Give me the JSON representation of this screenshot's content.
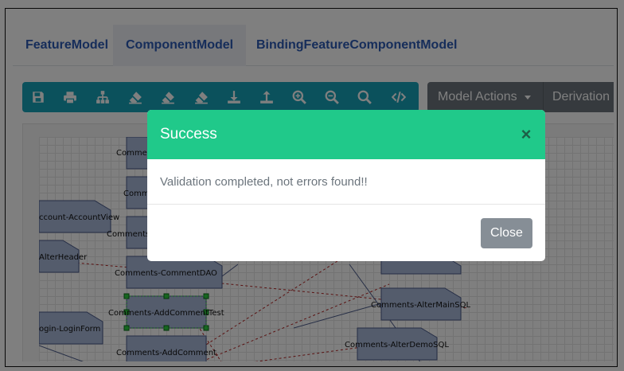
{
  "tabs": [
    {
      "label": "FeatureModel"
    },
    {
      "label": "ComponentModel"
    },
    {
      "label": "BindingFeatureComponentModel"
    }
  ],
  "toolbar": {
    "icons": [
      "save-icon",
      "print-icon",
      "hierarchy-icon",
      "eraser-icon",
      "eraser-icon",
      "eraser-icon",
      "download-icon",
      "upload-icon",
      "zoom-in-icon",
      "zoom-out-icon",
      "search-icon",
      "code-icon"
    ]
  },
  "model_actions": {
    "label": "Model Actions",
    "derivation_label": "Derivation"
  },
  "diagram": {
    "nodes": [
      {
        "label": "Comme"
      },
      {
        "label": "Comm"
      },
      {
        "label": "ccount-AccountView"
      },
      {
        "label": "Comments"
      },
      {
        "label": "AlterHeader"
      },
      {
        "label": "Comments-CommentDAO"
      },
      {
        "label": "Comments-AddCommentTest"
      },
      {
        "label": "Comments-AlterMainSQL"
      },
      {
        "label": "ogin-LoginForm"
      },
      {
        "label": "Comments-AlterDemoSQL"
      },
      {
        "label": "Comments-AddComment"
      }
    ]
  },
  "modal": {
    "title": "Success",
    "close_symbol": "×",
    "message": "Validation completed, not errors found!!",
    "close_button": "Close"
  },
  "colors": {
    "header_green": "#20c98a",
    "toolbar_teal": "#17a2b8",
    "model_actions_gray": "#6c757d",
    "close_button_gray": "#868e96",
    "tab_text_blue": "#2d5bb5"
  }
}
